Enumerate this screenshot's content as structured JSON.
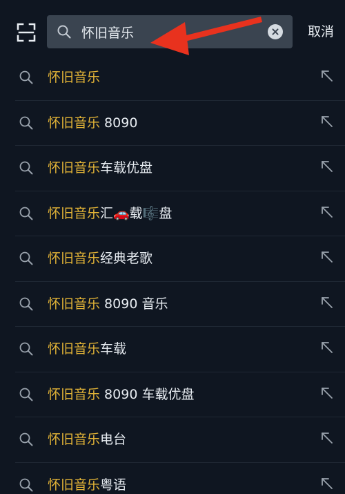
{
  "search": {
    "value": "怀旧音乐",
    "cancel_label": "取消"
  },
  "icons": {
    "scan": "scan-icon",
    "search": "search-icon",
    "clear": "clear-icon",
    "fill": "arrow-up-left-icon"
  },
  "colors": {
    "background": "#0f1621",
    "search_box": "#3a4450",
    "highlight": "#e3b437",
    "text": "#e8edf2",
    "annotation_arrow": "#e8321e"
  },
  "suggestions": [
    {
      "highlight": "怀旧音乐",
      "rest": ""
    },
    {
      "highlight": "怀旧音乐",
      "rest": " 8090"
    },
    {
      "highlight": "怀旧音乐",
      "rest": "车载优盘"
    },
    {
      "highlight": "怀旧音乐",
      "rest": "汇🚗载🎼盘"
    },
    {
      "highlight": "怀旧音乐",
      "rest": "经典老歌"
    },
    {
      "highlight": "怀旧音乐",
      "rest": " 8090 音乐"
    },
    {
      "highlight": "怀旧音乐",
      "rest": "车载"
    },
    {
      "highlight": "怀旧音乐",
      "rest": " 8090 车载优盘"
    },
    {
      "highlight": "怀旧音乐",
      "rest": "电台"
    },
    {
      "highlight": "怀旧音乐",
      "rest": "粤语"
    }
  ]
}
